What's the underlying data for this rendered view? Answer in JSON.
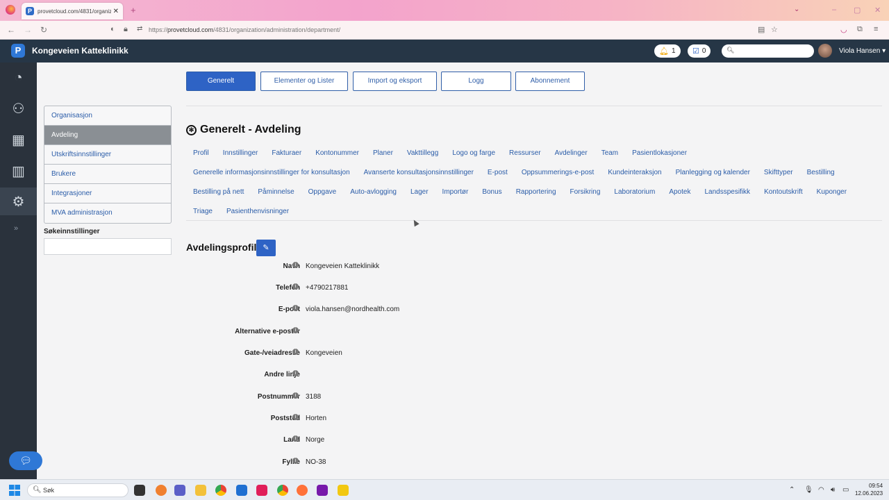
{
  "browser": {
    "tab_title": "provetcloud.com/4831/organiz",
    "url_prefix": "https://",
    "url_domain": "provetcloud.com",
    "url_path": "/4831/organization/administration/department/"
  },
  "header": {
    "clinic_name": "Kongeveien Katteklinikk",
    "notifications_count": "1",
    "tasks_count": "0",
    "user_name": "Viola Hansen"
  },
  "subnav": {
    "items": [
      "Organisasjon",
      "Avdeling",
      "Utskriftsinnstillinger",
      "Brukere",
      "Integrasjoner",
      "MVA administrasjon"
    ],
    "active_index": 1,
    "search_label": "Søkeinnstillinger"
  },
  "top_buttons": [
    "Generelt",
    "Elementer og Lister",
    "Import og eksport",
    "Logg",
    "Abonnement"
  ],
  "section_title": "Generelt - Avdeling",
  "tab_links": {
    "row1": [
      "Profil",
      "Innstillinger",
      "Fakturaer",
      "Kontonummer",
      "Planer",
      "Vakttillegg",
      "Logo og farge",
      "Ressurser",
      "Avdelinger",
      "Team",
      "Pasientlokasjoner"
    ],
    "row2": [
      "Generelle informasjonsinnstillinger for konsultasjon",
      "Avanserte konsultasjonsinnstillinger",
      "E-post",
      "Oppsummerings-e-post",
      "Kundeinteraksjon",
      "Planlegging og kalender",
      "Skifttyper",
      "Bestilling"
    ],
    "row3": [
      "Bestilling på nett",
      "Påminnelse",
      "Oppgave",
      "Auto-avlogging",
      "Lager",
      "Importør",
      "Bonus",
      "Rapportering",
      "Forsikring",
      "Laboratorium",
      "Apotek",
      "Landsspesifikk",
      "Kontoutskrift",
      "Kuponger"
    ],
    "row4": [
      "Triage",
      "Pasienthenvisninger"
    ]
  },
  "profile": {
    "title": "Avdelingsprofil",
    "fields": [
      {
        "label": "Navn",
        "value": "Kongeveien Katteklinikk"
      },
      {
        "label": "Telefon",
        "value": "+4790217881"
      },
      {
        "label": "E-post",
        "value": "viola.hansen@nordhealth.com"
      },
      {
        "label": "Alternative e-poster",
        "value": ""
      },
      {
        "label": "Gate-/veiadresse",
        "value": "Kongeveien"
      },
      {
        "label": "Andre linje",
        "value": ""
      },
      {
        "label": "Postnummer",
        "value": "3188"
      },
      {
        "label": "Poststed",
        "value": "Horten"
      },
      {
        "label": "Land",
        "value": "Norge"
      },
      {
        "label": "Fylke",
        "value": "NO-38"
      }
    ]
  },
  "taskbar": {
    "search_placeholder": "Søk",
    "time": "09:54",
    "date": "12.06.2023"
  },
  "colors": {
    "header_bg": "#263646",
    "primary": "#2e63c5",
    "rail_bg": "#2a323c",
    "link": "#2a5ca8"
  }
}
